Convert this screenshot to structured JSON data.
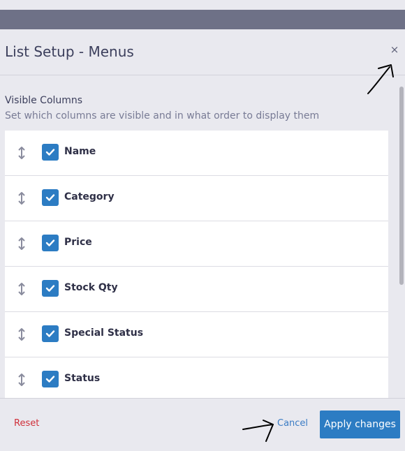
{
  "modal": {
    "title": "List Setup - Menus",
    "close_glyph": "×"
  },
  "section": {
    "title": "Visible Columns",
    "subtitle": "Set which columns are visible and in what order to display them"
  },
  "columns": [
    {
      "label": "Name",
      "checked": true
    },
    {
      "label": "Category",
      "checked": true
    },
    {
      "label": "Price",
      "checked": true
    },
    {
      "label": "Stock Qty",
      "checked": true
    },
    {
      "label": "Special Status",
      "checked": true
    },
    {
      "label": "Status",
      "checked": true
    }
  ],
  "footer": {
    "reset_label": "Reset",
    "cancel_label": "Cancel",
    "apply_label": "Apply changes"
  },
  "colors": {
    "accent": "#2c7cc3",
    "danger": "#d0303a",
    "link": "#3b7cc4",
    "backdrop_bar": "#6e7187"
  },
  "icons": {
    "drag": "drag-handle-icon",
    "check": "checkmark-icon",
    "close": "close-icon"
  }
}
